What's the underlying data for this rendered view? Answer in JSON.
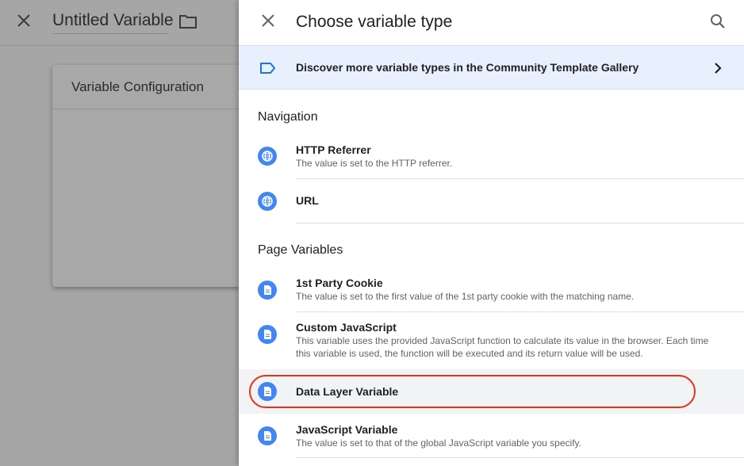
{
  "background": {
    "title": "Untitled Variable",
    "card_title": "Variable Configuration"
  },
  "drawer": {
    "title": "Choose variable type",
    "gallery_text": "Discover more variable types in the Community Template Gallery",
    "sections": [
      {
        "title": "Navigation",
        "items": [
          {
            "name": "HTTP Referrer",
            "description": "The value is set to the HTTP referrer.",
            "icon": "globe-icon"
          },
          {
            "name": "URL",
            "description": "",
            "icon": "globe-icon"
          }
        ]
      },
      {
        "title": "Page Variables",
        "items": [
          {
            "name": "1st Party Cookie",
            "description": "The value is set to the first value of the 1st party cookie with the matching name.",
            "icon": "document-icon"
          },
          {
            "name": "Custom JavaScript",
            "description": "This variable uses the provided JavaScript function to calculate its value in the browser. Each time this variable is used, the function will be executed and its return value will be used.",
            "icon": "document-icon"
          },
          {
            "name": "Data Layer Variable",
            "description": "",
            "icon": "document-icon",
            "highlighted": true
          },
          {
            "name": "JavaScript Variable",
            "description": "The value is set to that of the global JavaScript variable you specify.",
            "icon": "document-icon"
          }
        ]
      }
    ]
  },
  "colors": {
    "accent": "#4285f4",
    "gallery_bg": "#e8f0fe",
    "highlight_ring": "#e5321b",
    "overlay": "#a6a6a6"
  }
}
